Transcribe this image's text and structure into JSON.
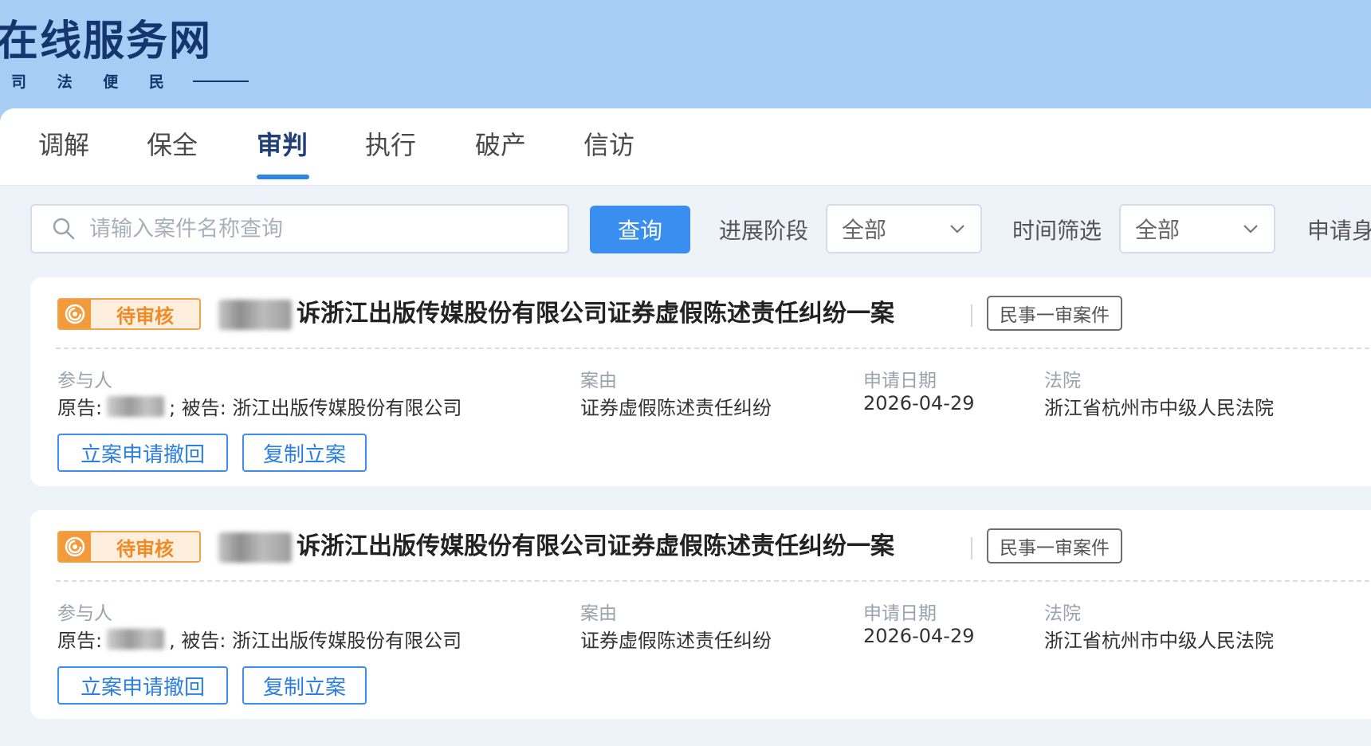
{
  "header": {
    "site_title": "在线服务网",
    "slogan": "司 法 便 民"
  },
  "tabs": [
    {
      "label": "调解"
    },
    {
      "label": "保全"
    },
    {
      "label": "审判"
    },
    {
      "label": "执行"
    },
    {
      "label": "破产"
    },
    {
      "label": "信访"
    }
  ],
  "active_tab": "审判",
  "filters": {
    "search_placeholder": "请输入案件名称查询",
    "query_label": "查询",
    "stage_label": "进展阶段",
    "stage_value": "全部",
    "time_label": "时间筛选",
    "time_value": "全部",
    "applicant_label": "申请身"
  },
  "cases": [
    {
      "status": "待审核",
      "title": "诉浙江出版传媒股份有限公司证券虚假陈述责任纠纷一案",
      "type_tag": "民事一审案件",
      "participants_label": "参与人",
      "plaintiff_prefix": "原告:",
      "defendant_text": "; 被告: 浙江出版传媒股份有限公司",
      "cause_label": "案由",
      "cause_value": "证券虚假陈述责任纠纷",
      "date_label": "申请日期",
      "date_value": "2026-04-29",
      "court_label": "法院",
      "court_value": "浙江省杭州市中级人民法院",
      "withdraw_label": "立案申请撤回",
      "copy_label": "复制立案"
    },
    {
      "status": "待审核",
      "title": "诉浙江出版传媒股份有限公司证券虚假陈述责任纠纷一案",
      "type_tag": "民事一审案件",
      "participants_label": "参与人",
      "plaintiff_prefix": "原告:",
      "defendant_text": ", 被告: 浙江出版传媒股份有限公司",
      "cause_label": "案由",
      "cause_value": "证券虚假陈述责任纠纷",
      "date_label": "申请日期",
      "date_value": "2026-04-29",
      "court_label": "法院",
      "court_value": "浙江省杭州市中级人民法院",
      "withdraw_label": "立案申请撤回",
      "copy_label": "复制立案"
    }
  ],
  "colors": {
    "brand": "#15356e",
    "accent": "#3a8ef0",
    "status": "#ef8a24",
    "banner": "#a7cdf4"
  }
}
